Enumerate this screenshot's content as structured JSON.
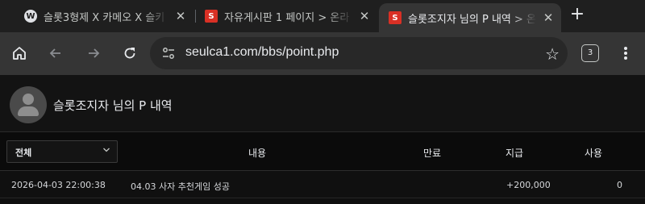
{
  "browser": {
    "tabs": [
      {
        "title": "슬롯3형제 X 카메오 X 슬키",
        "favicon": "wordpress-icon",
        "active": false
      },
      {
        "title": "자유게시판 1 페이지 > 온라",
        "favicon": "site-s-icon",
        "active": false
      },
      {
        "title": "슬롯조지자 님의 P 내역 > 온",
        "favicon": "site-s-icon",
        "active": true
      }
    ],
    "close_glyph": "✕",
    "new_tab_glyph": "+",
    "url": "seulca1.com/bbs/point.php",
    "extensions_count": "3",
    "favicon_letter": "S"
  },
  "page": {
    "title": "슬롯조지자 님의 P 내역",
    "filter": {
      "selected": "전체"
    },
    "columns": {
      "content": "내용",
      "expire": "만료",
      "earned": "지급",
      "used": "사용"
    },
    "rows": [
      {
        "datetime": "2026-04-03 22:00:38",
        "content": "04.03 사자 추천게임 성공",
        "expire": "",
        "earned": "+200,000",
        "used": "0"
      }
    ]
  },
  "colors": {
    "accent": "#d93025",
    "background": "#0f0f0f",
    "toolbar": "#353535"
  }
}
